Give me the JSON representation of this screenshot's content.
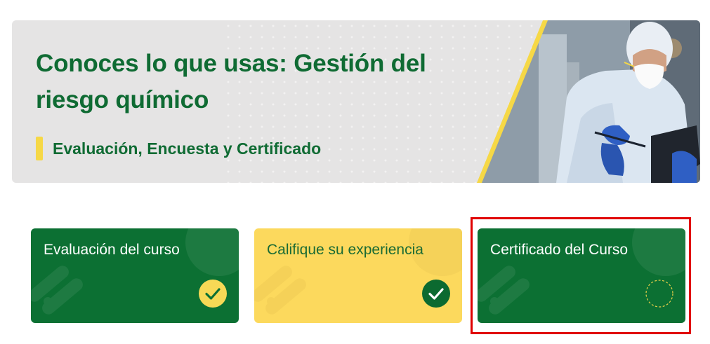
{
  "banner": {
    "title": "Conoces lo que usas: Gestión del riesgo químico",
    "subtitle": "Evaluación, Encuesta y Certificado",
    "image": "lab-worker-with-mask-and-clipboard"
  },
  "cards": [
    {
      "label": "Evaluación del curso",
      "status": "completed",
      "icon": "check-icon",
      "color": "#0c7033"
    },
    {
      "label": "Califique su experiencia",
      "status": "completed",
      "icon": "check-icon",
      "color": "#fcd95d"
    },
    {
      "label": "Certificado del Curso",
      "status": "pending",
      "icon": "dashed-circle-icon",
      "color": "#0c7033",
      "highlighted": true
    }
  ],
  "colors": {
    "brand_green": "#0f6b33",
    "accent_yellow": "#f6d846",
    "highlight_red": "#e00000"
  }
}
